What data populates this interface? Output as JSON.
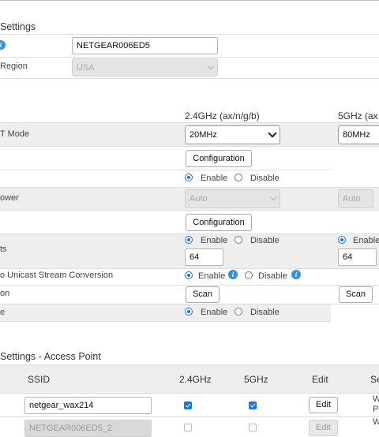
{
  "general": {
    "title": "Settings",
    "ssid_value": "NETGEAR006ED5",
    "region_label": "Region",
    "region_value": "USA"
  },
  "radio": {
    "col_24": "2.4GHz (ax/n/g/b)",
    "col_5": "5GHz (ax",
    "ht_mode_label": "T Mode",
    "ht_24": "20MHz",
    "ht_5": "80MHz",
    "config_label": "Configuration",
    "enable": "Enable",
    "disable": "Disable",
    "power_label": "ower",
    "power_24": "Auto",
    "power_5": "Auto",
    "dtim_label": "ts",
    "dtim_24": "64",
    "dtim_5": "64",
    "enable_5_partial": "Enable",
    "multicast_label": "o Unicast Stream Conversion",
    "scan_label_row": "on",
    "scan_button": "Scan",
    "last_row_label": "e"
  },
  "ap": {
    "title": "Settings - Access Point",
    "col_ssid": "SSID",
    "col_24": "2.4GHz",
    "col_5": "5GHz",
    "col_edit": "Edit",
    "col_se": "Se",
    "rows": [
      {
        "ssid": "netgear_wax214",
        "edit": "Edit",
        "se1": "W",
        "se2": "Pe"
      },
      {
        "ssid": "NETGEAR006ED5_2",
        "edit": "Edit",
        "se1": "W"
      }
    ]
  }
}
